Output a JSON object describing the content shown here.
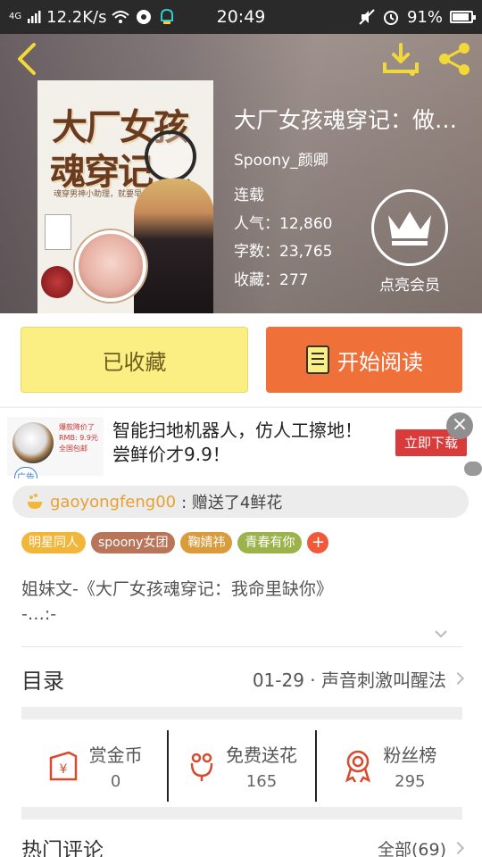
{
  "status_bar": {
    "network": "4G",
    "speed": "12.2K/s",
    "time": "20:49",
    "battery": "91%",
    "battery_level": 0.91
  },
  "book": {
    "title": "大厂女孩魂穿记：做…",
    "author": "Spoony_颜卿",
    "status": "连载",
    "popularity_label": "人气：",
    "popularity": "12,860",
    "words_label": "字数：",
    "words": "23,765",
    "favorites_label": "收藏：",
    "favorites": "277",
    "cover_title_line1": "大厂女孩",
    "cover_title_line2": "魂穿记",
    "cover_subtitle": "魂穿男神小助理，就要早点变帅的"
  },
  "vip": {
    "label": "点亮会员",
    "icon": "crown-icon"
  },
  "buttons": {
    "favorited": "已收藏",
    "start_reading": "开始阅读"
  },
  "ad": {
    "line1": "智能扫地机器人，仿人工擦地！",
    "line2": "尝鲜价才9.9！",
    "cta": "立即下载",
    "tag": "广告",
    "promo_line1": "爆款降价了",
    "promo_line2": "RMB: 9.9元",
    "promo_line3": "全国包邮"
  },
  "gift": {
    "user": "gaoyongfeng00",
    "action": " : 赠送了4鲜花"
  },
  "tags": [
    "明星同人",
    "spoony女团",
    "鞠婧祎",
    "青春有你"
  ],
  "description": {
    "line1": "姐妹文-《大厂女孩魂穿记：我命里缺你》",
    "line2": "-…:-"
  },
  "toc": {
    "label": "目录",
    "latest": "01-29 · 声音刺激叫醒法"
  },
  "stats": [
    {
      "name": "赏金币",
      "value": "0",
      "icon": "reward-coin-icon"
    },
    {
      "name": "免费送花",
      "value": "165",
      "icon": "flower-icon"
    },
    {
      "name": "粉丝榜",
      "value": "295",
      "icon": "medal-icon"
    }
  ],
  "comments": {
    "label": "热门评论",
    "all": "全部(69)"
  },
  "colors": {
    "accent_orange": "#f0703a",
    "favorited_yellow": "#fbef83",
    "ad_red": "#d93a3a",
    "gift_user": "#e8a032"
  }
}
